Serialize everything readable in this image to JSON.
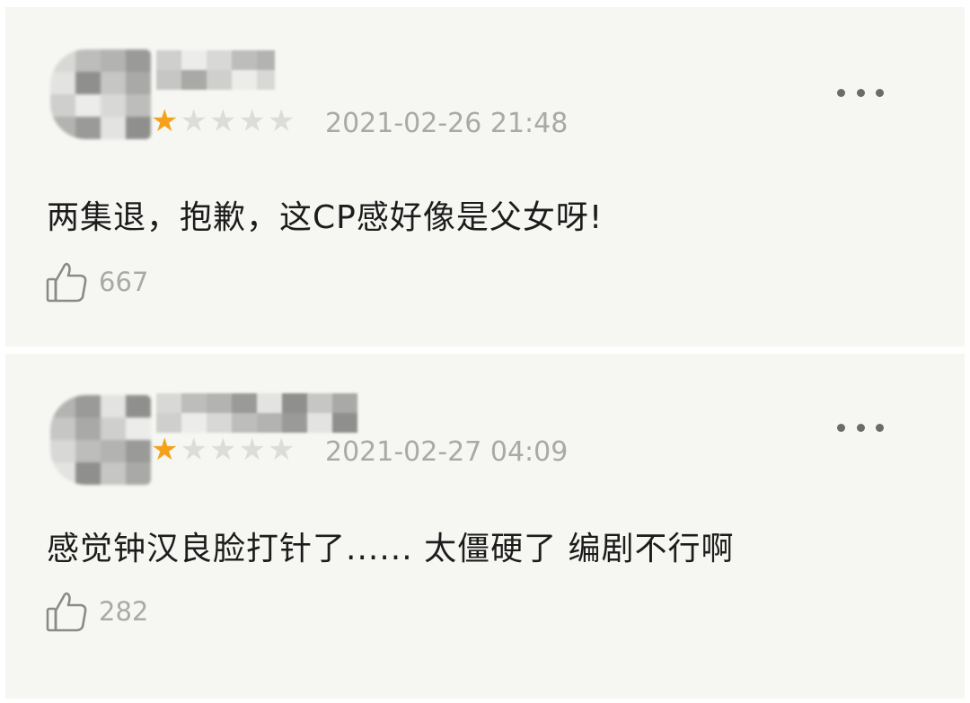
{
  "colors": {
    "card_background": "#f6f6f3",
    "star_filled": "#f4a21b",
    "star_empty": "#dcdcda",
    "meta_text": "#a9a9a6",
    "comment_text": "#1c1c1c"
  },
  "comments": [
    {
      "rating": "1 of 5",
      "rating_stars": 1,
      "timestamp": "2021-02-26 21:48",
      "text": "两集退，抱歉，这CP感好像是父女呀!",
      "like_count": "667"
    },
    {
      "rating": "1 of 5",
      "rating_stars": 1,
      "timestamp": "2021-02-27 04:09",
      "text": "感觉钟汉良脸打针了...... 太僵硬了  编剧不行啊",
      "like_count": "282"
    }
  ],
  "icons": {
    "more": "more-horizontal-icon",
    "like": "thumbs-up-icon",
    "star": "star-icon"
  }
}
